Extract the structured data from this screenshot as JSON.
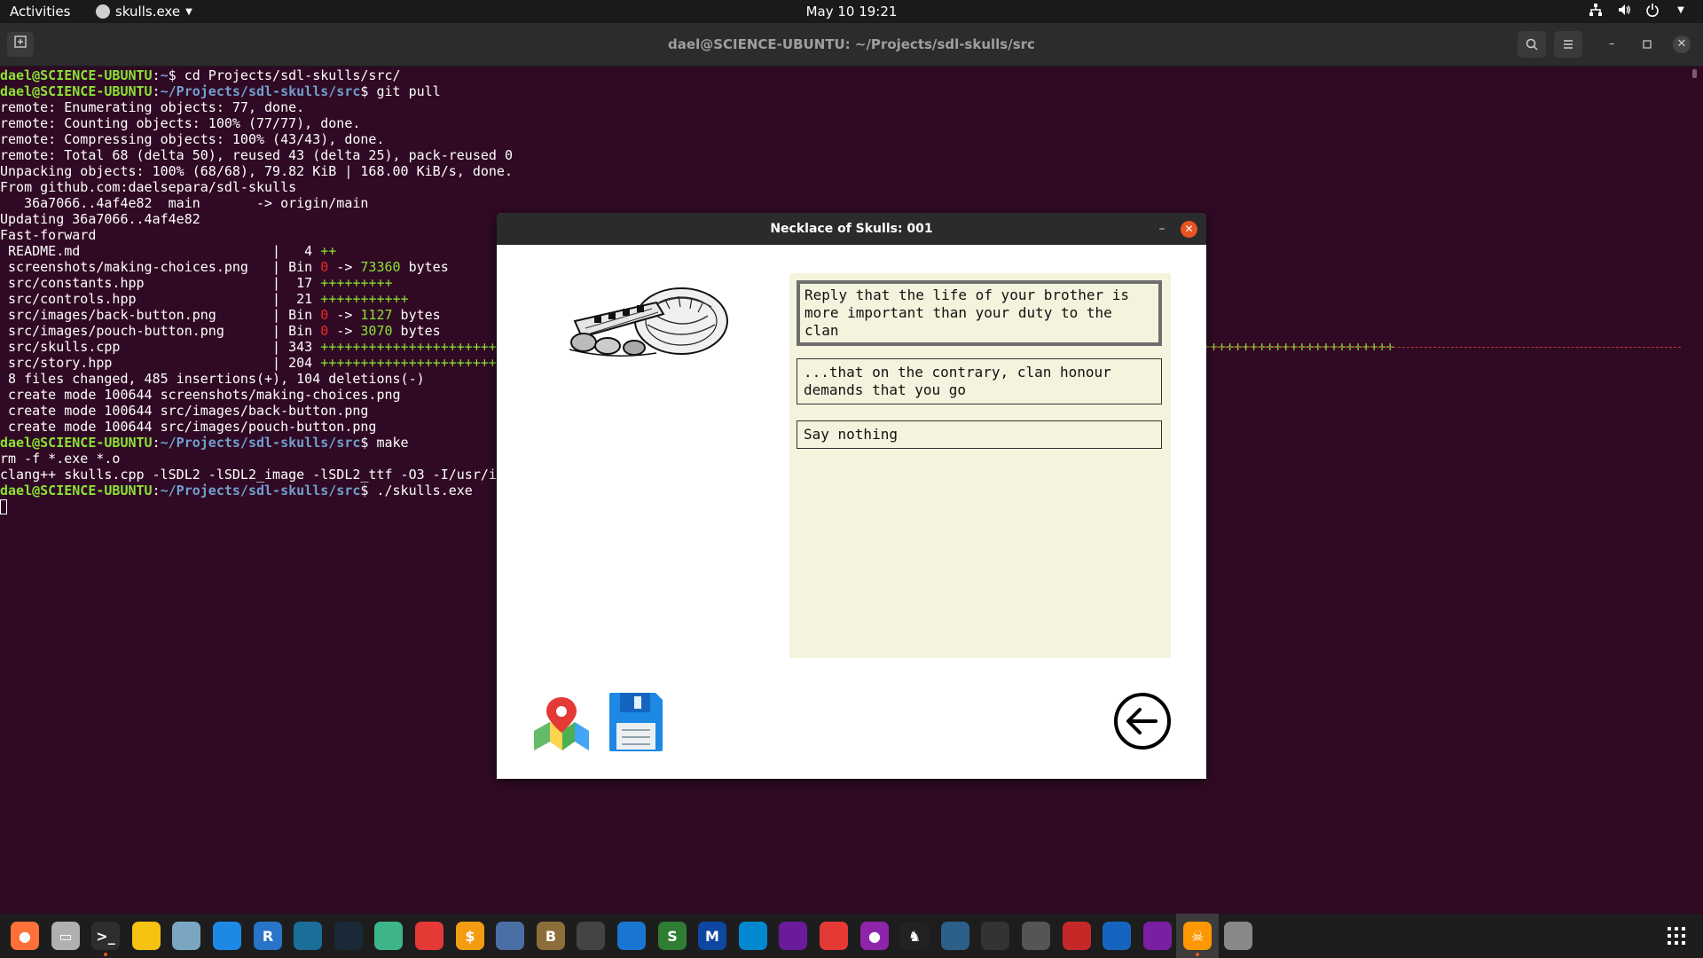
{
  "topbar": {
    "activities": "Activities",
    "app_name": "skulls.exe",
    "clock": "May 10  19:21",
    "tray_icons": [
      "network-icon",
      "volume-icon",
      "power-icon",
      "chevron-down-icon"
    ]
  },
  "terminal": {
    "title": "dael@SCIENCE-UBUNTU: ~/Projects/sdl-skulls/src",
    "prompt_user": "dael@SCIENCE-UBUNTU",
    "lines": [
      {
        "user": "dael@SCIENCE-UBUNTU",
        "path": "~",
        "cmd": "$ cd Projects/sdl-skulls/src/"
      },
      {
        "user": "dael@SCIENCE-UBUNTU",
        "path": "~/Projects/sdl-skulls/src",
        "cmd": "$ git pull"
      },
      {
        "text": "remote: Enumerating objects: 77, done."
      },
      {
        "text": "remote: Counting objects: 100% (77/77), done."
      },
      {
        "text": "remote: Compressing objects: 100% (43/43), done."
      },
      {
        "text": "remote: Total 68 (delta 50), reused 43 (delta 25), pack-reused 0"
      },
      {
        "text": "Unpacking objects: 100% (68/68), 79.82 KiB | 168.00 KiB/s, done."
      },
      {
        "text": "From github.com:daelsepara/sdl-skulls"
      },
      {
        "text": "   36a7066..4af4e82  main       -> origin/main"
      },
      {
        "text": "Updating 36a7066..4af4e82"
      },
      {
        "text": "Fast-forward"
      },
      {
        "file": " README.md                        |   4 ",
        "plus": "++"
      },
      {
        "file": " screenshots/making-choices.png   | Bin ",
        "zero": "0",
        "arrow": " -> ",
        "size": "73360",
        "unit": " bytes"
      },
      {
        "file": " src/constants.hpp                |  17 ",
        "plus": "+++++++++"
      },
      {
        "file": " src/controls.hpp                 |  21 ",
        "plus": "+++++++++++"
      },
      {
        "file": " src/images/back-button.png       | Bin ",
        "zero": "0",
        "arrow": " -> ",
        "size": "1127",
        "unit": " bytes"
      },
      {
        "file": " src/images/pouch-button.png      | Bin ",
        "zero": "0",
        "arrow": " -> ",
        "size": "3070",
        "unit": " bytes"
      },
      {
        "file": " src/skulls.cpp                   | 343 ",
        "plus": "+++++++++++++++++++++++++"
      },
      {
        "file": " src/story.hpp                    | 204 ",
        "plus": "+++++++++++++++++++++++++"
      },
      {
        "text": " 8 files changed, 485 insertions(+), 104 deletions(-)"
      },
      {
        "text": " create mode 100644 screenshots/making-choices.png"
      },
      {
        "text": " create mode 100644 src/images/back-button.png"
      },
      {
        "text": " create mode 100644 src/images/pouch-button.png"
      },
      {
        "user": "dael@SCIENCE-UBUNTU",
        "path": "~/Projects/sdl-skulls/src",
        "cmd": "$ make"
      },
      {
        "text": "rm -f *.exe *.o"
      },
      {
        "text": "clang++ skulls.cpp -lSDL2 -lSDL2_image -lSDL2_ttf -O3 -I/usr/i"
      },
      {
        "user": "dael@SCIENCE-UBUNTU",
        "path": "~/Projects/sdl-skulls/src",
        "cmd": "$ ./skulls.exe"
      }
    ],
    "plus_tail": "++++++++++++++++++++++++"
  },
  "game": {
    "title": "Necklace of Skulls: 001",
    "minimize": "–",
    "close": "✕",
    "choices": [
      {
        "text": "Reply that the life of your brother is more important than your duty to the clan",
        "selected": true
      },
      {
        "text": "...that on the contrary, clan honour demands that you go",
        "selected": false
      },
      {
        "text": "Say nothing",
        "selected": false
      }
    ],
    "buttons": {
      "map": "map-icon",
      "save": "floppy-disk-icon",
      "back": "back-arrow-icon"
    }
  },
  "dock": {
    "apps": [
      "firefox",
      "files",
      "terminal",
      "gnome-games",
      "app",
      "vscode",
      "R",
      "app",
      "steam",
      "app",
      "app",
      "money",
      "app",
      "dosbox",
      "app",
      "dolphin",
      "S",
      "MFE",
      "app",
      "app",
      "app",
      "grape",
      "chess",
      "app",
      "app",
      "app",
      "app",
      "app",
      "app",
      "skulls",
      "app"
    ]
  },
  "colors": {
    "terminal_bg": "#300a24",
    "prompt_user": "#8ae234",
    "prompt_path": "#729fcf",
    "diff_plus": "#8ae234",
    "diff_zero": "#ef2929",
    "choices_bg": "#f4f3dd",
    "accent": "#e95420"
  }
}
